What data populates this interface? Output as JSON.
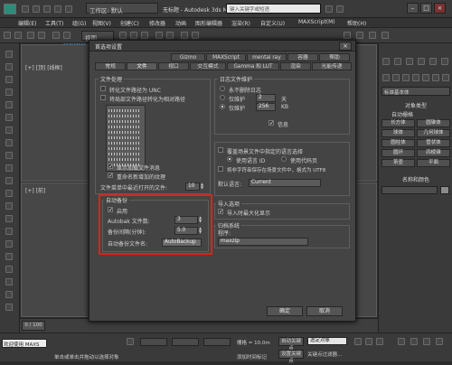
{
  "titlebar": {
    "workspace": "工作区: 默认",
    "title": "无标题 - Autodesk 3ds Max 2014 x64",
    "search_placeholder": "键入关键字或短语",
    "menu_items": [
      "编辑(E)",
      "工具(T)",
      "组(G)",
      "视图(V)",
      "创建(C)",
      "修改器",
      "动画",
      "图形编辑器",
      "渲染(R)",
      "自定义(U)",
      "MAXScript(M)",
      "帮助(H)"
    ]
  },
  "toolbar": {
    "view_label": "视图"
  },
  "watermark": "www.pc0359.cn",
  "viewports": {
    "top_left_label": "[+] [顶] [线框]",
    "bottom_left_label": "[+] [前]"
  },
  "dialog": {
    "title": "首选项设置",
    "tabs_row1": [
      "Gizmo",
      "MAXScript",
      "mental ray",
      "容器",
      "帮助"
    ],
    "tabs_row2": [
      "常规",
      "文件",
      "视口",
      "交互模式",
      "Gamma 和 LUT",
      "渲染",
      "光能传递"
    ],
    "selected_tab": "文件",
    "file_handling": {
      "title": "文件处理",
      "unc_label": "转化文件路径为 UNC",
      "relative_label": "将局部文件路径转化为相对路径",
      "show_file_msg": "显示加载文件消息",
      "autobak_label": "重命名新增加的纹理",
      "recent_label": "文件菜单中最近打开的文件:",
      "recent_value": "10"
    },
    "log": {
      "title": "日志文件维护",
      "never_delete": "永不删除日志",
      "keep_days": "仅维护",
      "days_value": "2",
      "days_unit": "天",
      "keep_kb": "仅维护",
      "kb_value": "256",
      "kb_unit": "KB",
      "info_label": "信息"
    },
    "language": {
      "scene_label": "覆盖场景文件中指定的语言选择",
      "use_lang_id": "使用语言 ID",
      "use_codepage": "使用代码页",
      "utf8_label": "将非字符串保存在场景文件中，格式为 UTF8",
      "default_lang_label": "默认语言:",
      "default_lang_value": "Current"
    },
    "autobackup": {
      "title": "自动备份",
      "enable_label": "启用",
      "count_label": "Autobak 文件数:",
      "count_value": "3",
      "interval_label": "备份间隔(分钟):",
      "interval_value": "5.0",
      "filename_label": "自动备份文件名:",
      "filename_value": "AutoBackup"
    },
    "import": {
      "title": "导入选项",
      "zoom_label": "导入时最大化显示"
    },
    "archive": {
      "title": "归档系统",
      "program_label": "程序:",
      "program_value": "maxzip"
    },
    "ok_label": "确定",
    "cancel_label": "取消"
  },
  "rightpanel": {
    "dropdown": "标准基本体",
    "object_type_title": "对象类型",
    "auto_grid": "自动栅格",
    "buttons": [
      "长方体",
      "圆锥体",
      "球体",
      "几何球体",
      "圆柱体",
      "管状体",
      "圆环",
      "四棱锥",
      "茶壶",
      "平面"
    ],
    "name_color_title": "名称和颜色"
  },
  "status": {
    "welcome": "欢迎使用 MAXS",
    "hint": "单击或单击并拖动以选择对象",
    "time_field": "0 / 100",
    "grid_label": "栅格 = 10.0m",
    "auto_key": "自动关键点",
    "set_key": "设置关键点",
    "selected_object": "选定对象",
    "key_filter": "关键点过滤器...",
    "add_time_tag": "添加时间标记",
    "none_selected": "未选定任何对象"
  }
}
